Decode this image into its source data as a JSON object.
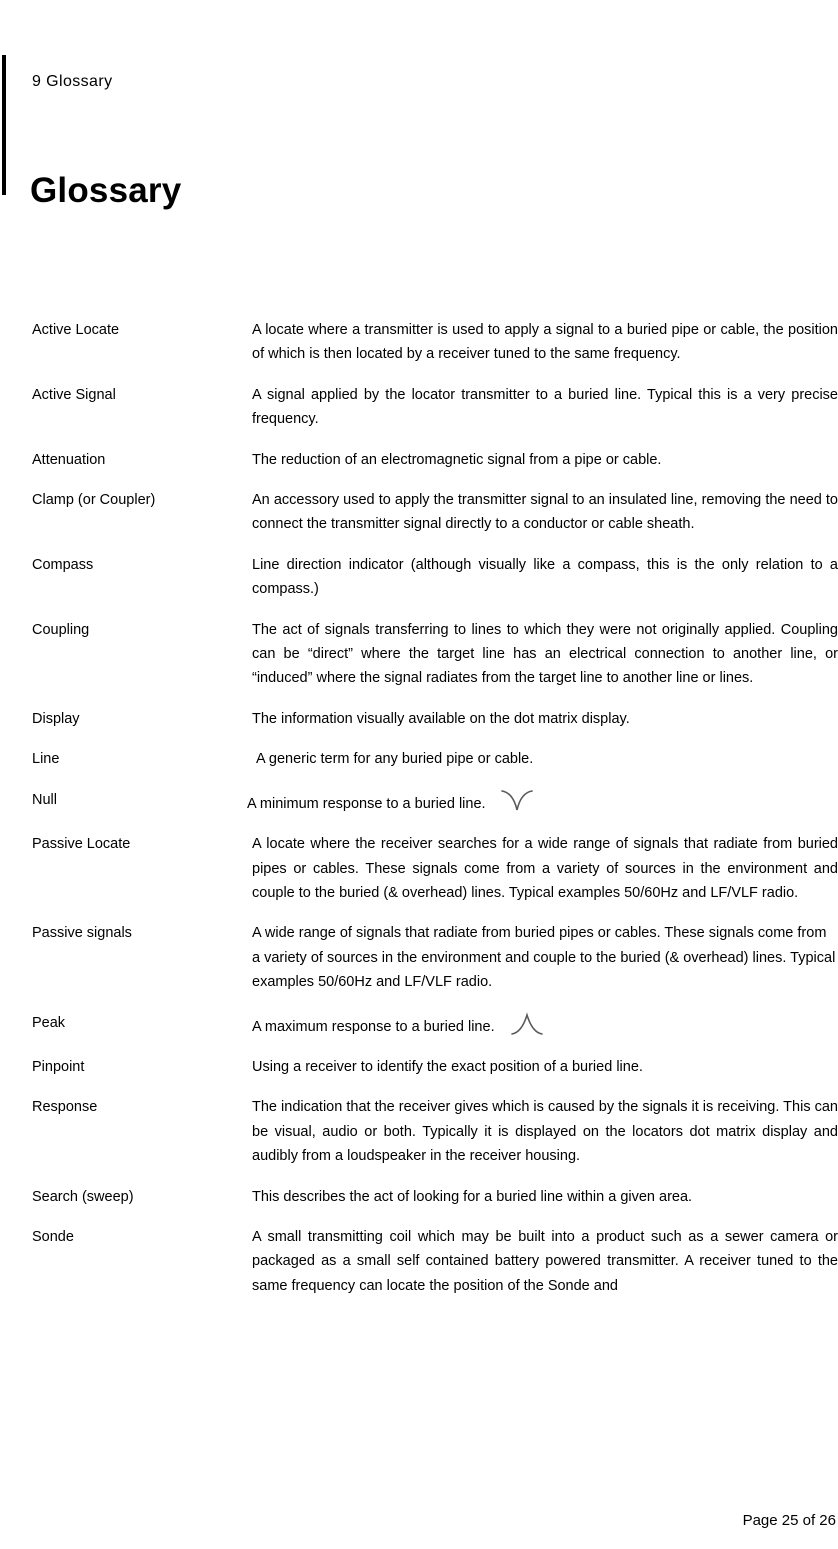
{
  "header": {
    "running_head": "9 Glossary",
    "rule_color": "#000000"
  },
  "title": "Glossary",
  "glossary": {
    "entries": [
      {
        "term": "Active Locate",
        "definition": "A locate where a transmitter is used to apply a signal to a buried pipe or cable, the position of which is then located by a receiver tuned to the same frequency."
      },
      {
        "term": "Active Signal",
        "definition": "A signal applied by the locator transmitter to a buried line. Typical this is a very precise frequency."
      },
      {
        "term": "Attenuation",
        "definition": "The reduction of an electromagnetic signal from a pipe or cable."
      },
      {
        "term": "Clamp (or Coupler)",
        "definition": "An accessory used to apply the transmitter signal to an insulated line, removing the need to connect the transmitter signal directly to a conductor or cable sheath."
      },
      {
        "term": "Compass",
        "definition": "Line direction indicator (although visually like a compass, this is the only relation to a compass.)"
      },
      {
        "term": "Coupling",
        "definition": "The act of signals transferring to lines to which they were not originally applied. Coupling can be “direct” where the target line has an electrical connection to another line, or “induced” where the signal radiates from the target line to another line or lines."
      },
      {
        "term": "Display",
        "definition": "The information visually available on the dot matrix display."
      },
      {
        "term": "Line",
        "definition": "A generic term for any buried pipe or cable."
      },
      {
        "term": "Null",
        "definition": "A minimum response to a buried line.",
        "glyph": "null-response-curve-icon"
      },
      {
        "term": "Passive Locate",
        "definition": "A locate where the receiver searches for a wide range of signals that radiate from buried pipes or cables. These signals come from a variety of sources in the environment and couple to the buried (& overhead) lines. Typical examples 50/60Hz and LF/VLF radio."
      },
      {
        "term": "Passive signals",
        "definition": "A wide range of signals that radiate from buried pipes or cables. These signals come from a variety of sources in the environment and couple to the buried (& overhead) lines. Typical examples 50/60Hz and LF/VLF radio."
      },
      {
        "term": "Peak",
        "definition": "A maximum response to a buried line.",
        "glyph": "peak-response-curve-icon"
      },
      {
        "term": "Pinpoint",
        "definition": "Using a receiver to identify the exact position of a buried line."
      },
      {
        "term": "Response",
        "definition": "The indication that the receiver gives which is caused by the signals it is receiving. This can be visual, audio or both. Typically it is displayed on the locators dot matrix display and audibly from a loudspeaker in the receiver housing."
      },
      {
        "term": "Search (sweep)",
        "definition": "This describes the act of looking for a buried line within a given area."
      },
      {
        "term": "Sonde",
        "definition": "A small transmitting coil which may be built into a product such as a sewer camera or packaged as a small self contained battery powered transmitter. A receiver tuned to the same frequency can locate the position of the Sonde and"
      }
    ]
  },
  "footer": {
    "page_label": "Page 25 of 26"
  }
}
